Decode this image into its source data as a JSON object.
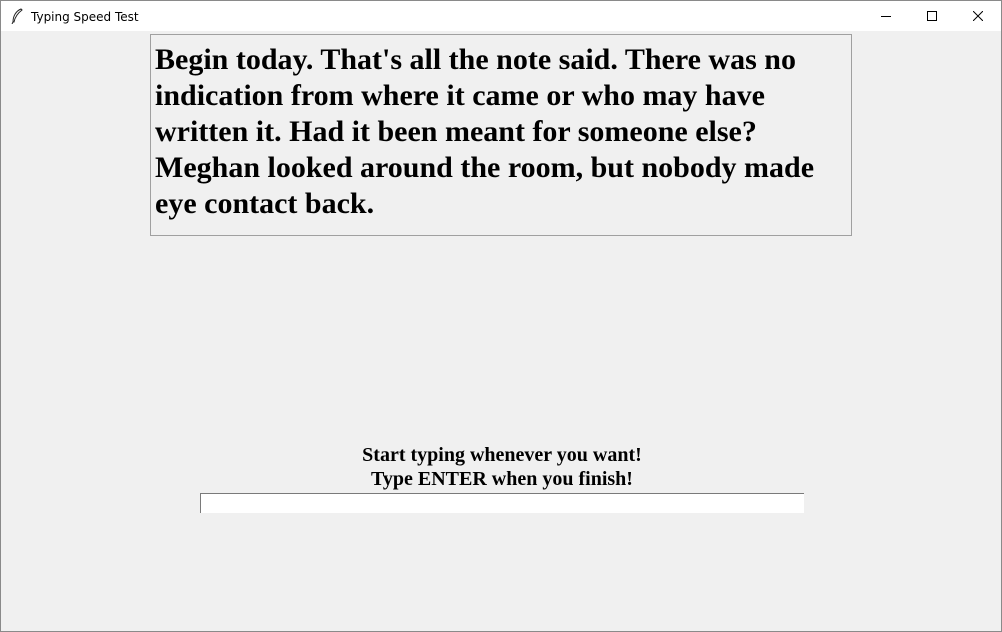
{
  "window": {
    "title": "Typing Speed Test",
    "app_icon": "feather-icon",
    "controls": {
      "minimize_icon": "minimize-icon",
      "maximize_icon": "maximize-icon",
      "close_icon": "close-icon"
    }
  },
  "passage": {
    "text": "Begin today. That's all the note said. There was no indication from where it came or who may have written it. Had it been meant for someone else? Meghan looked around the room, but nobody made eye contact back."
  },
  "instructions": {
    "line1": "Start typing whenever you want!",
    "line2": "Type ENTER when you finish!"
  },
  "typing_input": {
    "value": "",
    "placeholder": ""
  },
  "colors": {
    "window_bg": "#f0f0f0",
    "titlebar_bg": "#ffffff",
    "input_bg": "#ffffff"
  }
}
